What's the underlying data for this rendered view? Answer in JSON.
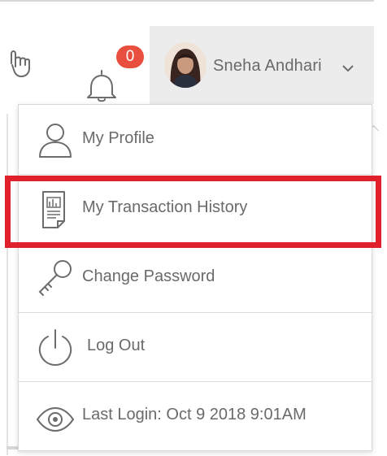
{
  "header": {
    "notifications": {
      "icon": "bell-icon",
      "count": "0"
    },
    "touch_icon": "hand-pointer-icon",
    "user": {
      "name": "Sneha Andhari",
      "avatar_icon": "user-avatar",
      "chevron_icon": "chevron-down-icon"
    }
  },
  "menu": {
    "items": [
      {
        "label": "My Profile",
        "icon": "user-icon"
      },
      {
        "label": "My Transaction History",
        "icon": "document-icon"
      },
      {
        "label": "Change Password",
        "icon": "key-icon"
      },
      {
        "label": "Log Out",
        "icon": "power-icon"
      },
      {
        "label": "Last Login: Oct 9 2018 9:01AM",
        "icon": "eye-icon"
      }
    ]
  },
  "colors": {
    "badge": "#e94f3e",
    "highlight_box": "#e0202b",
    "user_button_bg": "#ececec"
  }
}
